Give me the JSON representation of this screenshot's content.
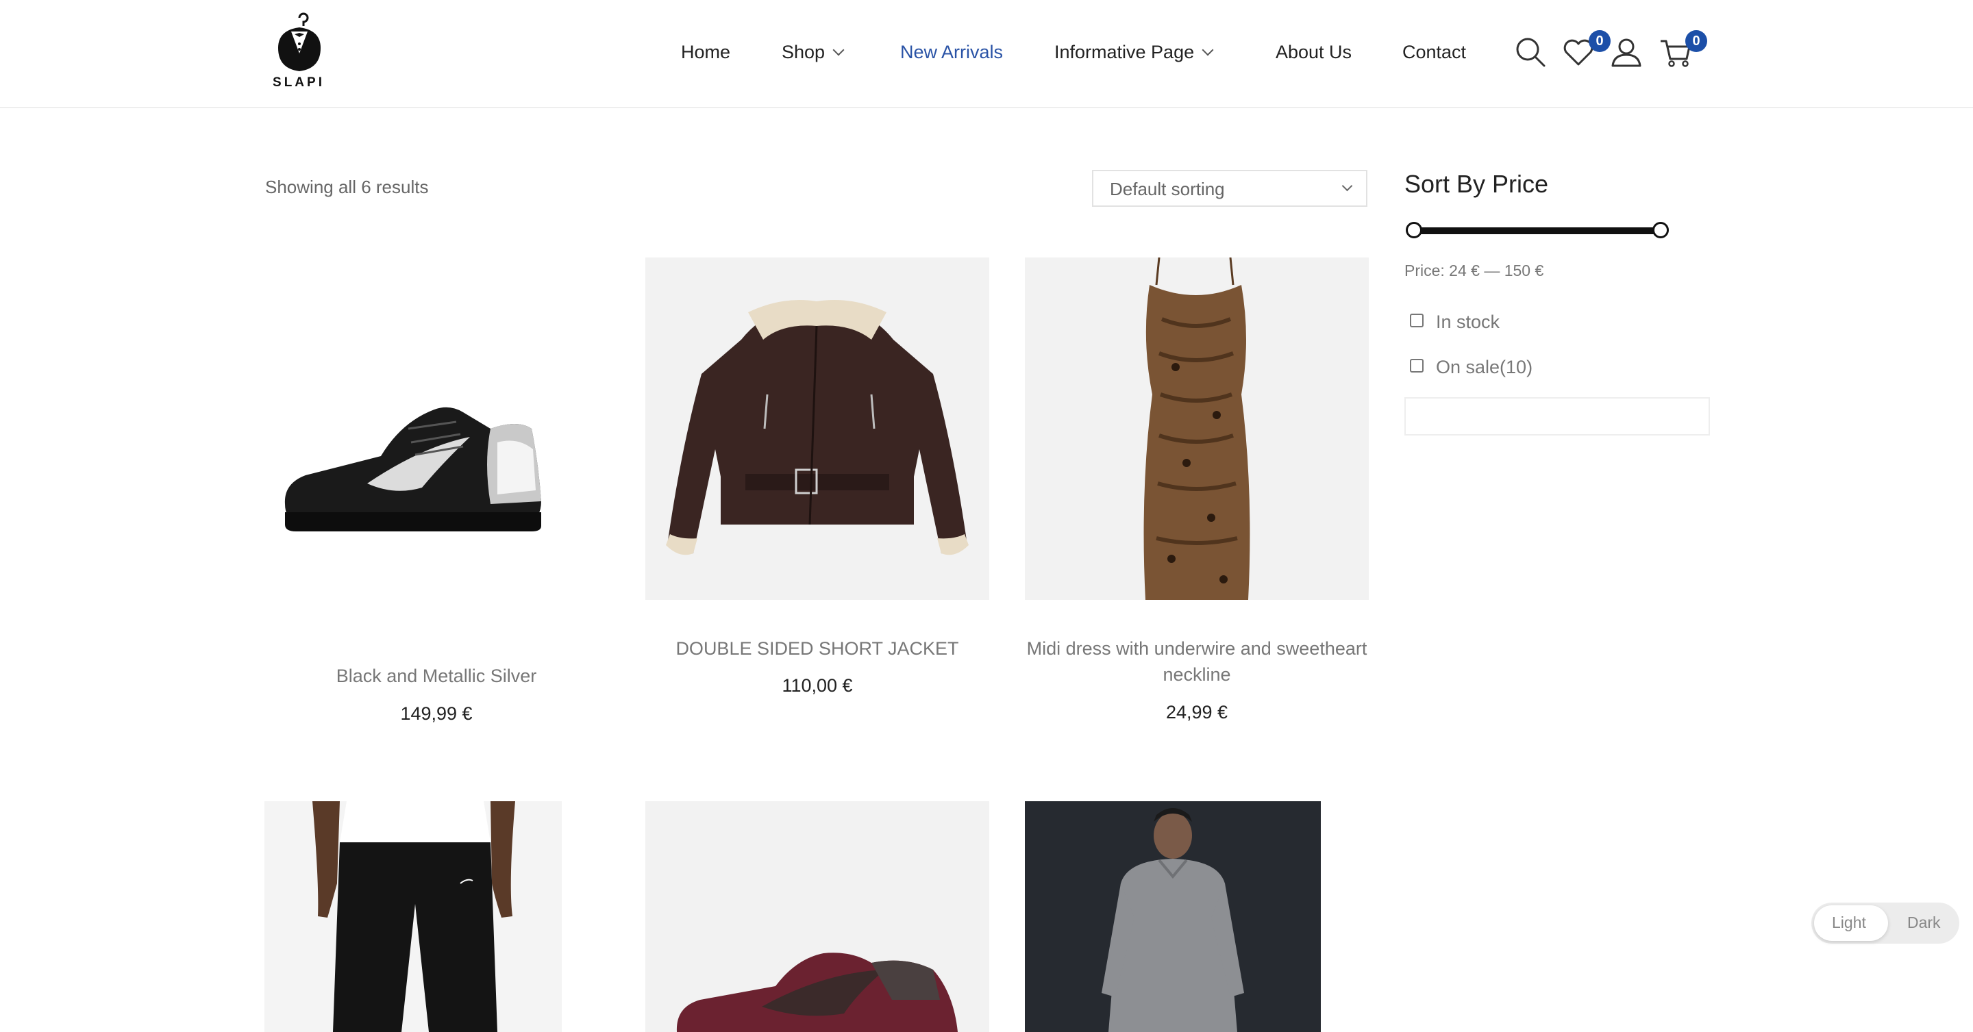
{
  "brand": {
    "name": "SLAPI"
  },
  "nav": {
    "items": [
      {
        "label": "Home"
      },
      {
        "label": "Shop"
      },
      {
        "label": "New Arrivals"
      },
      {
        "label": "Informative Page"
      },
      {
        "label": "About Us"
      },
      {
        "label": "Contact"
      }
    ],
    "active_color": "#2a53a6"
  },
  "header_icons": {
    "search": "search-icon",
    "wishlist": {
      "icon": "heart-icon",
      "count": "0"
    },
    "account": "user-icon",
    "cart": {
      "icon": "cart-icon",
      "count": "0"
    },
    "badge_color": "#1c4fa8"
  },
  "toolbar": {
    "result_count": "Showing all 6 results",
    "sort_selected": "Default sorting"
  },
  "products": [
    {
      "title": "Black and Metallic Silver",
      "price": "149,99 €"
    },
    {
      "title": "DOUBLE SIDED SHORT JACKET",
      "price": "110,00 €"
    },
    {
      "title": "Midi dress with underwire and sweetheart neckline",
      "price": "24,99 €"
    },
    {
      "title": "",
      "price": ""
    },
    {
      "title": "",
      "price": ""
    },
    {
      "title": "",
      "price": ""
    }
  ],
  "sidebar": {
    "title": "Sort By Price",
    "price_label": "Price: 24 € — 150 €",
    "price_min": 24,
    "price_max": 150,
    "in_stock": "In stock",
    "on_sale": "On sale(10)"
  },
  "theme_toggle": {
    "light": "Light",
    "dark": "Dark",
    "selected": "Light"
  }
}
